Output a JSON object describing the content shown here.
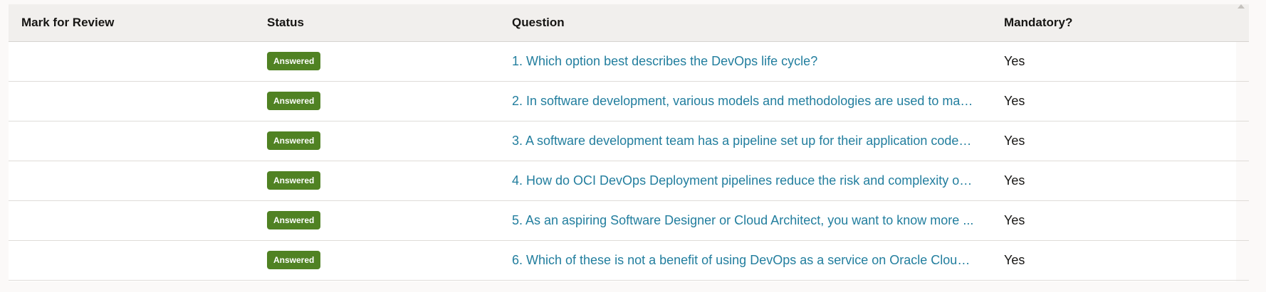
{
  "table": {
    "headers": {
      "review": "Mark for Review",
      "status": "Status",
      "question": "Question",
      "mandatory": "Mandatory?"
    },
    "rows": [
      {
        "status": "Answered",
        "question": "1. Which option best describes the DevOps life cycle?",
        "mandatory": "Yes"
      },
      {
        "status": "Answered",
        "question": "2. In software development, various models and methodologies are used to man...",
        "mandatory": "Yes"
      },
      {
        "status": "Answered",
        "question": "3. A software development team has a pipeline set up for their application code, ...",
        "mandatory": "Yes"
      },
      {
        "status": "Answered",
        "question": "4. How do OCI DevOps Deployment pipelines reduce the risk and complexity of ...",
        "mandatory": "Yes"
      },
      {
        "status": "Answered",
        "question": "5. As an aspiring Software Designer or Cloud Architect, you want to know more ...",
        "mandatory": "Yes"
      },
      {
        "status": "Answered",
        "question": "6. Which of these is not a benefit of using DevOps as a service on Oracle Cloud I...",
        "mandatory": "Yes"
      }
    ]
  },
  "colors": {
    "badge": "#508223",
    "link": "#227e9e",
    "header_bg": "#f1efed"
  }
}
